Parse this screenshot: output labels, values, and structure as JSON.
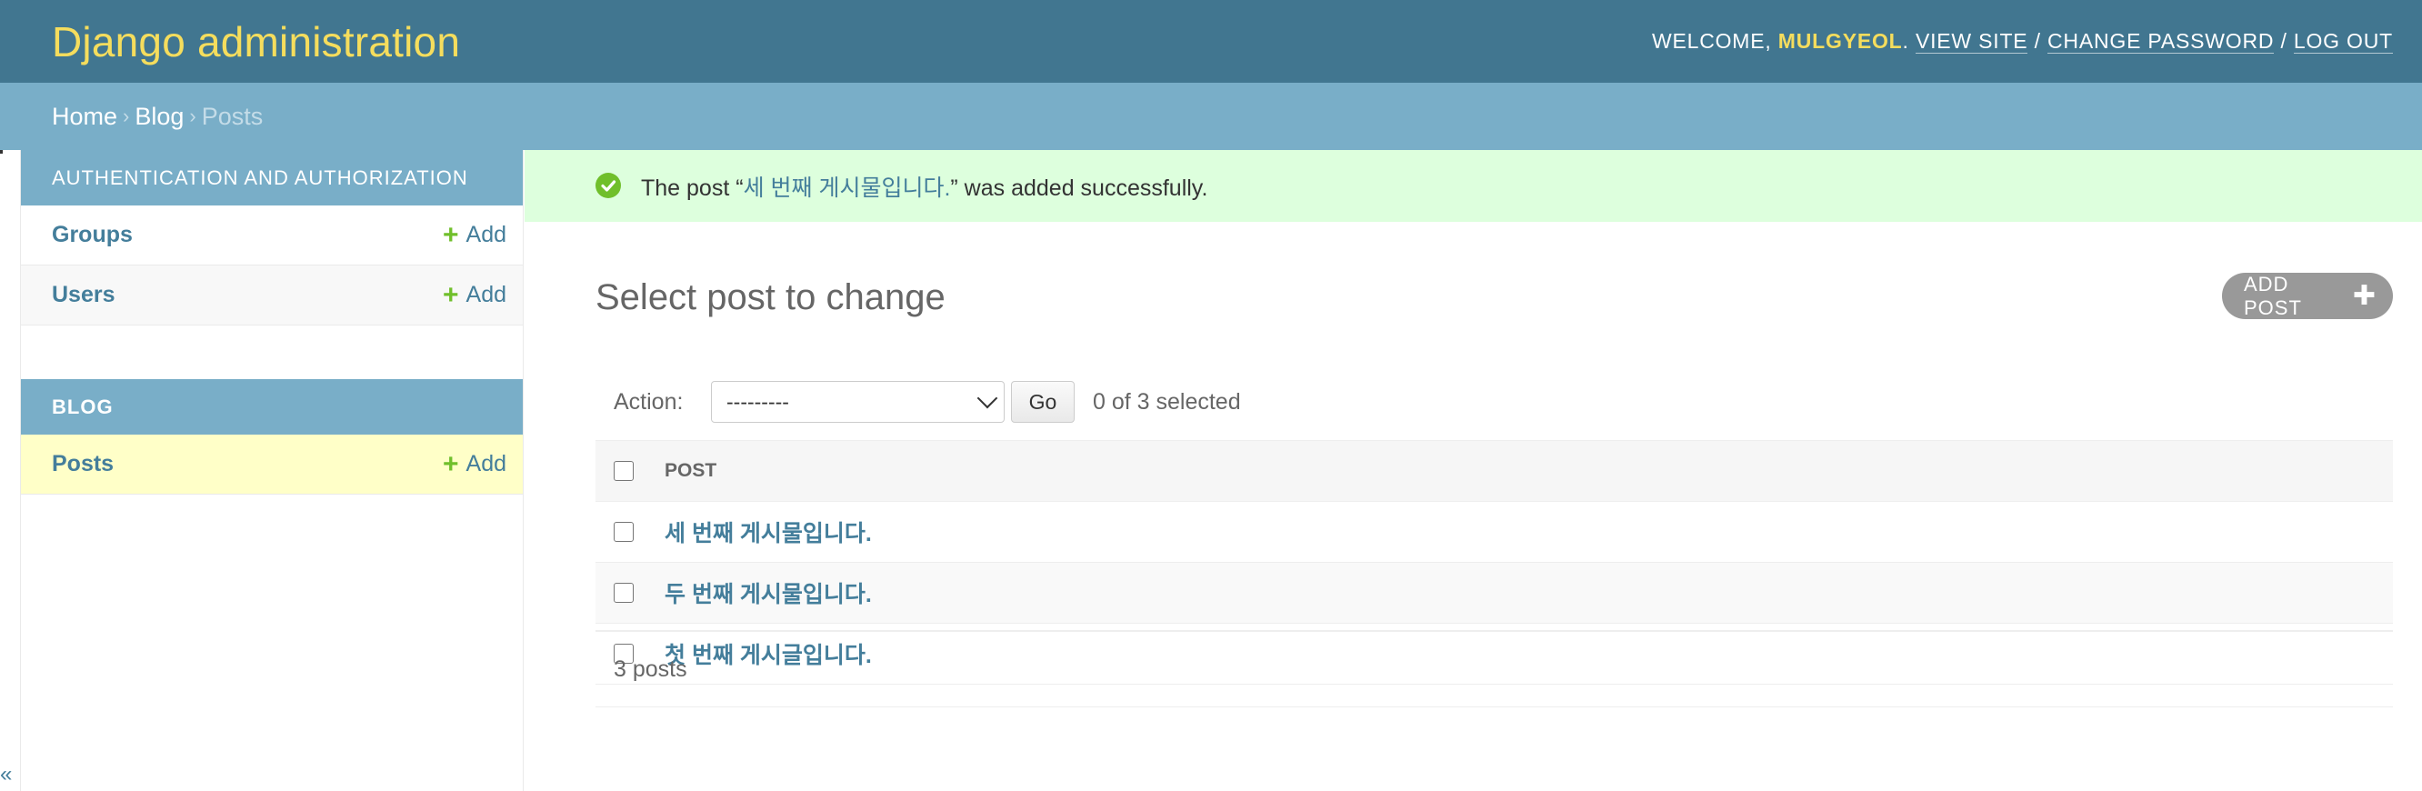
{
  "header": {
    "site_title": "Django administration",
    "welcome_text": "WELCOME, ",
    "username": "MULGYEOL",
    "period": ".",
    "view_site": "VIEW SITE",
    "change_password": "CHANGE PASSWORD",
    "log_out": "LOG OUT",
    "separator": " / "
  },
  "breadcrumbs": {
    "home": "Home",
    "app": "Blog",
    "current": "Posts",
    "separator": "›"
  },
  "sidebar": {
    "modules": [
      {
        "caption": "AUTHENTICATION AND AUTHORIZATION",
        "rows": [
          {
            "label": "Groups",
            "add": "Add"
          },
          {
            "label": "Users",
            "add": "Add"
          }
        ]
      },
      {
        "caption": "BLOG",
        "rows": [
          {
            "label": "Posts",
            "add": "Add"
          }
        ]
      }
    ],
    "toggle_glyph": "«"
  },
  "message": {
    "prefix": "The post “",
    "link": "세 번째 게시물입니다.",
    "suffix": "” was added successfully."
  },
  "content": {
    "title": "Select post to change",
    "add_button": "ADD POST",
    "action_label": "Action:",
    "action_selected": "---------",
    "go_button": "Go",
    "selected_count": "0 of 3 selected",
    "column_header": "POST",
    "rows": [
      "세 번째 게시물입니다.",
      "두 번째 게시물입니다.",
      "첫 번째 게시글입니다."
    ],
    "paginator": "3 posts"
  },
  "colors": {
    "header_bg": "#417690",
    "breadcrumb_bg": "#79aec8",
    "brand_yellow": "#f5dd5d",
    "link": "#447e9b",
    "success_bg": "#ddffdd",
    "add_green": "#70bf2b"
  },
  "icons": [
    "success-check-icon",
    "add-plus-icon",
    "dropdown-chevron-icon"
  ]
}
